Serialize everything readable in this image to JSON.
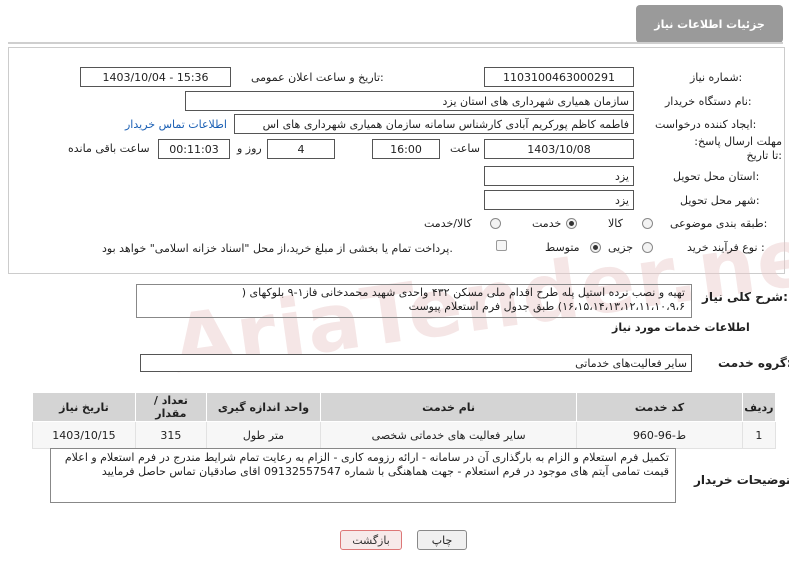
{
  "header": {
    "title": "جزئیات اطلاعات نیاز"
  },
  "fields": {
    "need_number_label": "شماره نیاز:",
    "need_number": "1103100463000291",
    "announce_label": "تاریخ و ساعت اعلان عمومی:",
    "announce_value": "1403/10/04 - 15:36",
    "buyer_org_label": "نام دستگاه خریدار:",
    "buyer_org": "سازمان همیاری شهرداری های استان یزد",
    "requester_label": "ایجاد کننده درخواست:",
    "requester": "فاطمه کاظم پورکریم آبادی کارشناس سامانه سازمان همیاری شهرداری های اس",
    "contact_link": "اطلاعات تماس خریدار",
    "deadline_label": "مهلت ارسال پاسخ: تا تاریخ:",
    "deadline_date": "1403/10/08",
    "time_label": "ساعت",
    "deadline_time": "16:00",
    "days_value": "4",
    "days_label": "روز و",
    "remaining_time": "00:11:03",
    "remaining_label": "ساعت باقی مانده",
    "province_label": "استان محل تحویل:",
    "province": "یزد",
    "city_label": "شهر محل تحویل:",
    "city": "یزد",
    "category_label": "طبقه بندی موضوعی:",
    "category_options": [
      "کالا",
      "خدمت",
      "کالا/خدمت"
    ],
    "category_selected": "خدمت",
    "process_label": "نوع فرآیند خرید :",
    "process_options": [
      "جزیی",
      "متوسط"
    ],
    "process_selected": "متوسط",
    "payment_note": "پرداخت تمام یا بخشی از مبلغ خرید،از محل \"اسناد خزانه اسلامی\" خواهد بود."
  },
  "summary": {
    "label": "شرح کلی نیاز:",
    "text": "تهیه و نصب نرده استیل پله طرح اقدام ملی مسکن ۴۳۲ واحدی شهید محمدخانی فاز۱-۹ بلوکهای ( ۱۶،۱۵،۱۴،۱۳،۱۲،۱۱،۱۰،۹،۶) طبق جدول فرم استعلام پیوست"
  },
  "services": {
    "section_title": "اطلاعات خدمات مورد نیاز",
    "group_label": "گروه خدمت:",
    "group_value": "سایر فعالیت‌های خدماتی",
    "columns": [
      "ردیف",
      "کد خدمت",
      "نام خدمت",
      "واحد اندازه گیری",
      "تعداد / مقدار",
      "تاریخ نیاز"
    ],
    "rows": [
      [
        "1",
        "ط-96-960",
        "سایر فعالیت های خدماتی شخصی",
        "متر طول",
        "315",
        "1403/10/15"
      ]
    ]
  },
  "buyer_notes": {
    "label": "توضیحات خریدار:",
    "text": "تکمیل فرم استعلام و الزام به بارگذاری آن در سامانه - ارائه رزومه کاری - الزام به رعایت تمام شرایط مندرج در فرم استعلام و اعلام قیمت تمامی آیتم های موجود در فرم استعلام - جهت هماهنگی با شماره 09132557547 اقای صادقیان تماس حاصل فرمایید"
  },
  "buttons": {
    "print": "چاپ",
    "back": "بازگشت"
  },
  "watermark": "AriaTender.neT"
}
